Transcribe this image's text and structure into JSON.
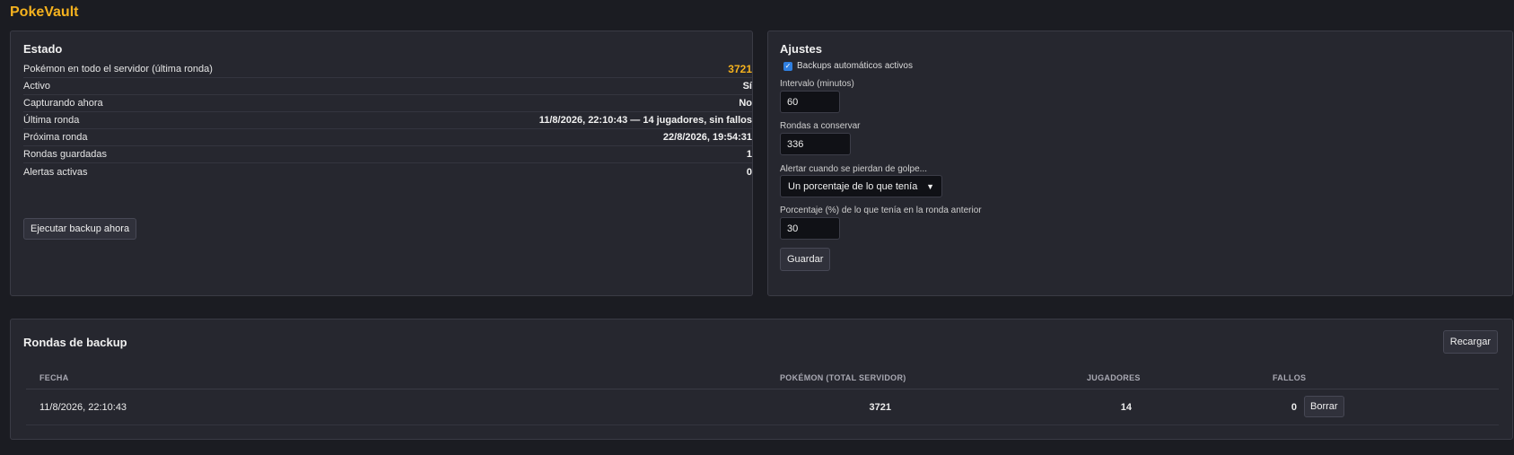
{
  "app": {
    "title": "PokeVault"
  },
  "estado": {
    "title": "Estado",
    "rows": [
      {
        "label": "Pokémon en todo el servidor (última ronda)",
        "value": "3721"
      },
      {
        "label": "Activo",
        "value": "Sí"
      },
      {
        "label": "Capturando ahora",
        "value": "No"
      },
      {
        "label": "Última ronda",
        "value": "11/8/2026, 22:10:43 — 14 jugadores, sin fallos"
      },
      {
        "label": "Próxima ronda",
        "value": "22/8/2026, 19:54:31"
      },
      {
        "label": "Rondas guardadas",
        "value": "1"
      },
      {
        "label": "Alertas activas",
        "value": "0"
      }
    ],
    "run_button": "Ejecutar backup ahora"
  },
  "ajustes": {
    "title": "Ajustes",
    "auto_backups_label": "Backups automáticos activos",
    "auto_backups_checked": true,
    "interval_label": "Intervalo (minutos)",
    "interval_value": "60",
    "keep_label": "Rondas a conservar",
    "keep_value": "336",
    "alert_label": "Alertar cuando se pierdan de golpe...",
    "alert_selected": "Un porcentaje de lo que tenía",
    "percent_label": "Porcentaje (%) de lo que tenía en la ronda anterior",
    "percent_value": "30",
    "save_button": "Guardar"
  },
  "rondas": {
    "title": "Rondas de backup",
    "reload_button": "Recargar",
    "columns": [
      "FECHA",
      "POKÉMON (TOTAL SERVIDOR)",
      "JUGADORES",
      "FALLOS"
    ],
    "rows": [
      {
        "fecha": "11/8/2026, 22:10:43",
        "pokemon": "3721",
        "jugadores": "14",
        "fallos": "0",
        "delete_label": "Borrar"
      }
    ]
  },
  "colors": {
    "accent": "#f5b21e",
    "background": "#1b1c22",
    "card": "#26272f",
    "checkbox": "#2f7fe0"
  },
  "icons": {
    "checkbox": "checkmark-icon",
    "select": "chevron-down-icon"
  }
}
